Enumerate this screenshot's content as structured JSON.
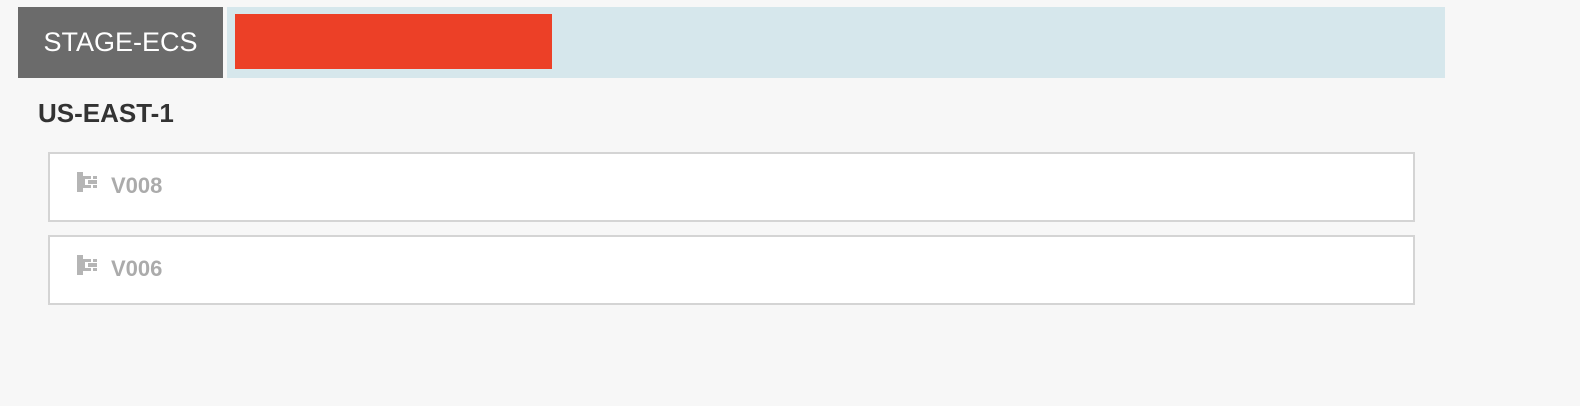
{
  "cluster": {
    "name": "STAGE-ECS",
    "health_color": "#ec4027",
    "health_fraction": 0.26
  },
  "region": {
    "name": "US-EAST-1"
  },
  "server_groups": [
    {
      "label": "V008",
      "icon": "server-group-icon"
    },
    {
      "label": "V006",
      "icon": "server-group-icon"
    }
  ]
}
